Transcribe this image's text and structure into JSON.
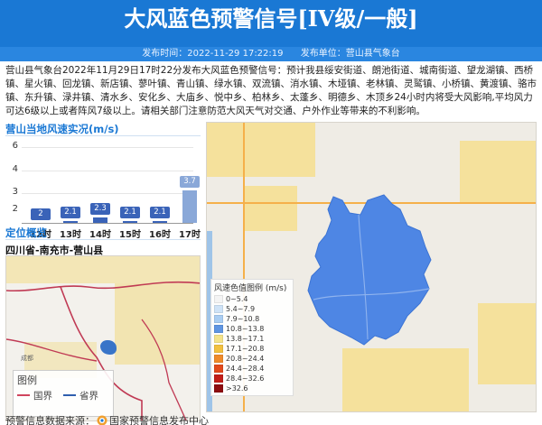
{
  "header": {
    "title": "大风蓝色预警信号[IV级/一般]",
    "publish_time_label": "发布时间：2022-11-29 17:22:19",
    "publisher_label": "发布单位：营山县气象台"
  },
  "body": {
    "text": "营山县气象台2022年11月29日17时22分发布大风蓝色预警信号：预计我县绥安街道、朗池街道、城南街道、望龙湖镇、西桥镇、星火镇、回龙镇、新店镇、蓼叶镇、青山镇、绿水镇、双流镇、消水镇、木垭镇、老林镇、灵鹫镇、小桥镇、黄渡镇、骆市镇、东升镇、渌井镇、清水乡、安化乡、大庙乡、悦中乡、柏林乡、太蓬乡、明德乡、木顶乡24小时内将受大风影响,平均风力可达6级以上或者阵风7级以上。请相关部门注意防范大风天气对交通、户外作业等带来的不利影响。"
  },
  "wind": {
    "title": "营山当地风速实况(m/s)",
    "y_ticks": [
      "6",
      "4",
      "3",
      "2"
    ]
  },
  "chart_data": {
    "type": "bar",
    "title": "营山当地风速实况(m/s)",
    "categories": [
      "12时",
      "13时",
      "14时",
      "15时",
      "16时",
      "17时"
    ],
    "values": [
      2,
      2.1,
      2.3,
      2.1,
      2.1,
      3.7
    ],
    "labels": [
      "2",
      "2.1",
      "2.3",
      "2.1",
      "2.1",
      "3.7"
    ],
    "ylim": [
      2,
      6
    ],
    "y_ticks": [
      2,
      3,
      4,
      6
    ],
    "bar_color": "#3a63b8",
    "grid": true
  },
  "location": {
    "title": "定位概览",
    "text": "四川省-南充市-营山县"
  },
  "mini_map": {
    "city_label": "成都",
    "legend_title": "图例",
    "legend_items": [
      {
        "label": "国界",
        "color": "#d0455e"
      },
      {
        "label": "省界",
        "color": "#2f5fae"
      }
    ]
  },
  "main_map": {
    "legend_title": "风速色值图例 (m/s)",
    "legend_rows": [
      {
        "label": "0~5.4",
        "color": "#f4f4f4"
      },
      {
        "label": "5.4~7.9",
        "color": "#cfe3f7"
      },
      {
        "label": "7.9~10.8",
        "color": "#a9cdf2"
      },
      {
        "label": "10.8~13.8",
        "color": "#5f95e2"
      },
      {
        "label": "13.8~17.1",
        "color": "#f4e38a"
      },
      {
        "label": "17.1~20.8",
        "color": "#f2c140"
      },
      {
        "label": "20.8~24.4",
        "color": "#ef8a2a"
      },
      {
        "label": "24.4~28.4",
        "color": "#e24a1c"
      },
      {
        "label": "28.4~32.6",
        "color": "#c21e18"
      },
      {
        "label": ">32.6",
        "color": "#8e0d10"
      }
    ],
    "county_color": "#4e86e4"
  },
  "footer": {
    "prefix": "预警信息数据来源：",
    "source": "国家预警信息发布中心"
  }
}
